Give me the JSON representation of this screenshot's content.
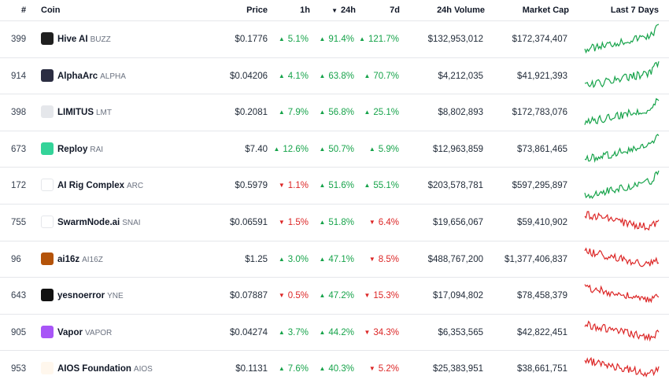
{
  "headers": {
    "rank": "#",
    "coin": "Coin",
    "price": "Price",
    "h1": "1h",
    "h24": "24h",
    "d7": "7d",
    "volume": "24h Volume",
    "mcap": "Market Cap",
    "last7": "Last 7 Days",
    "sort_arrow": "▼"
  },
  "colors": {
    "up": "#16a34a",
    "down": "#dc2626"
  },
  "rows": [
    {
      "rank": "399",
      "name": "Hive AI",
      "symbol": "BUZZ",
      "price": "$0.1776",
      "h1": "5.1%",
      "h1_dir": "up",
      "h24": "91.4%",
      "h24_dir": "up",
      "d7": "121.7%",
      "d7_dir": "up",
      "volume": "$132,953,012",
      "mcap": "$172,374,407",
      "logo_color": "#1f1f1f",
      "icon": "bee-icon",
      "trend": "up"
    },
    {
      "rank": "914",
      "name": "AlphaArc",
      "symbol": "ALPHA",
      "price": "$0.04206",
      "h1": "4.1%",
      "h1_dir": "up",
      "h24": "63.8%",
      "h24_dir": "up",
      "d7": "70.7%",
      "d7_dir": "up",
      "volume": "$4,212,035",
      "mcap": "$41,921,393",
      "logo_color": "#2b2d42",
      "icon": "arc-icon",
      "trend": "up"
    },
    {
      "rank": "398",
      "name": "LIMITUS",
      "symbol": "LMT",
      "price": "$0.2081",
      "h1": "7.9%",
      "h1_dir": "up",
      "h24": "56.8%",
      "h24_dir": "up",
      "d7": "25.1%",
      "d7_dir": "up",
      "volume": "$8,802,893",
      "mcap": "$172,783,076",
      "logo_color": "#e5e7eb",
      "icon": "limitus-icon",
      "trend": "up"
    },
    {
      "rank": "673",
      "name": "Reploy",
      "symbol": "RAI",
      "price": "$7.40",
      "h1": "12.6%",
      "h1_dir": "up",
      "h24": "50.7%",
      "h24_dir": "up",
      "d7": "5.9%",
      "d7_dir": "up",
      "volume": "$12,963,859",
      "mcap": "$73,861,465",
      "logo_color": "#34d399",
      "icon": "reploy-icon",
      "trend": "up"
    },
    {
      "rank": "172",
      "name": "AI Rig Complex",
      "symbol": "ARC",
      "price": "$0.5979",
      "h1": "1.1%",
      "h1_dir": "down",
      "h24": "51.6%",
      "h24_dir": "up",
      "d7": "55.1%",
      "d7_dir": "up",
      "volume": "$203,578,781",
      "mcap": "$597,295,897",
      "logo_color": "#ffffff",
      "icon": "rig-icon",
      "trend": "up"
    },
    {
      "rank": "755",
      "name": "SwarmNode.ai",
      "symbol": "SNAI",
      "price": "$0.06591",
      "h1": "1.5%",
      "h1_dir": "down",
      "h24": "51.8%",
      "h24_dir": "up",
      "d7": "6.4%",
      "d7_dir": "down",
      "volume": "$19,656,067",
      "mcap": "$59,410,902",
      "logo_color": "#ffffff",
      "icon": "swarm-icon",
      "trend": "down"
    },
    {
      "rank": "96",
      "name": "ai16z",
      "symbol": "AI16Z",
      "price": "$1.25",
      "h1": "3.0%",
      "h1_dir": "up",
      "h24": "47.1%",
      "h24_dir": "up",
      "d7": "8.5%",
      "d7_dir": "down",
      "volume": "$488,767,200",
      "mcap": "$1,377,406,837",
      "logo_color": "#b45309",
      "icon": "ai16z-icon",
      "trend": "down"
    },
    {
      "rank": "643",
      "name": "yesnoerror",
      "symbol": "YNE",
      "price": "$0.07887",
      "h1": "0.5%",
      "h1_dir": "down",
      "h24": "47.2%",
      "h24_dir": "up",
      "d7": "15.3%",
      "d7_dir": "down",
      "volume": "$17,094,802",
      "mcap": "$78,458,379",
      "logo_color": "#111111",
      "icon": "yne-icon",
      "trend": "down"
    },
    {
      "rank": "905",
      "name": "Vapor",
      "symbol": "VAPOR",
      "price": "$0.04274",
      "h1": "3.7%",
      "h1_dir": "up",
      "h24": "44.2%",
      "h24_dir": "up",
      "d7": "34.3%",
      "d7_dir": "down",
      "volume": "$6,353,565",
      "mcap": "$42,822,451",
      "logo_color": "#a855f7",
      "icon": "vapor-icon",
      "trend": "down"
    },
    {
      "rank": "953",
      "name": "AIOS Foundation",
      "symbol": "AIOS",
      "price": "$0.1131",
      "h1": "7.6%",
      "h1_dir": "up",
      "h24": "40.3%",
      "h24_dir": "up",
      "d7": "5.2%",
      "d7_dir": "down",
      "volume": "$25,383,951",
      "mcap": "$38,661,751",
      "logo_color": "#fff7ed",
      "icon": "aios-icon",
      "trend": "down"
    }
  ]
}
